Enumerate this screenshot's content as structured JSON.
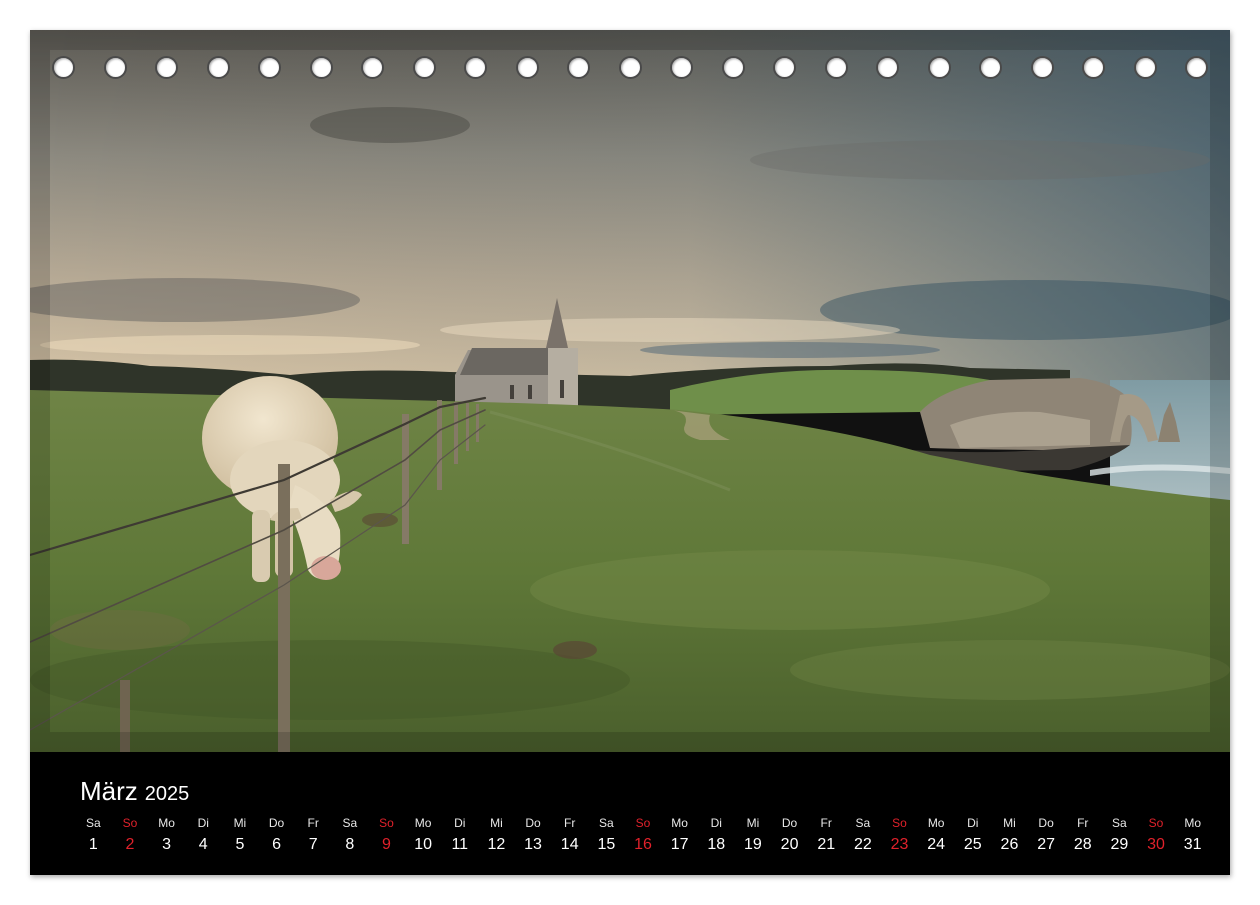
{
  "calendar": {
    "month": "März",
    "year": "2025",
    "days": [
      {
        "weekday": "Sa",
        "number": "1",
        "sunday": false
      },
      {
        "weekday": "So",
        "number": "2",
        "sunday": true
      },
      {
        "weekday": "Mo",
        "number": "3",
        "sunday": false
      },
      {
        "weekday": "Di",
        "number": "4",
        "sunday": false
      },
      {
        "weekday": "Mi",
        "number": "5",
        "sunday": false
      },
      {
        "weekday": "Do",
        "number": "6",
        "sunday": false
      },
      {
        "weekday": "Fr",
        "number": "7",
        "sunday": false
      },
      {
        "weekday": "Sa",
        "number": "8",
        "sunday": false
      },
      {
        "weekday": "So",
        "number": "9",
        "sunday": true
      },
      {
        "weekday": "Mo",
        "number": "10",
        "sunday": false
      },
      {
        "weekday": "Di",
        "number": "11",
        "sunday": false
      },
      {
        "weekday": "Mi",
        "number": "12",
        "sunday": false
      },
      {
        "weekday": "Do",
        "number": "13",
        "sunday": false
      },
      {
        "weekday": "Fr",
        "number": "14",
        "sunday": false
      },
      {
        "weekday": "Sa",
        "number": "15",
        "sunday": false
      },
      {
        "weekday": "So",
        "number": "16",
        "sunday": true
      },
      {
        "weekday": "Mo",
        "number": "17",
        "sunday": false
      },
      {
        "weekday": "Di",
        "number": "18",
        "sunday": false
      },
      {
        "weekday": "Mi",
        "number": "19",
        "sunday": false
      },
      {
        "weekday": "Do",
        "number": "20",
        "sunday": false
      },
      {
        "weekday": "Fr",
        "number": "21",
        "sunday": false
      },
      {
        "weekday": "Sa",
        "number": "22",
        "sunday": false
      },
      {
        "weekday": "So",
        "number": "23",
        "sunday": true
      },
      {
        "weekday": "Mo",
        "number": "24",
        "sunday": false
      },
      {
        "weekday": "Di",
        "number": "25",
        "sunday": false
      },
      {
        "weekday": "Mi",
        "number": "26",
        "sunday": false
      },
      {
        "weekday": "Do",
        "number": "27",
        "sunday": false
      },
      {
        "weekday": "Fr",
        "number": "28",
        "sunday": false
      },
      {
        "weekday": "Sa",
        "number": "29",
        "sunday": false
      },
      {
        "weekday": "So",
        "number": "30",
        "sunday": true
      },
      {
        "weekday": "Mo",
        "number": "31",
        "sunday": false
      }
    ]
  },
  "colors": {
    "strip_background": "#000000",
    "sunday": "#e0212b",
    "weekday_text": "#ffffff"
  }
}
